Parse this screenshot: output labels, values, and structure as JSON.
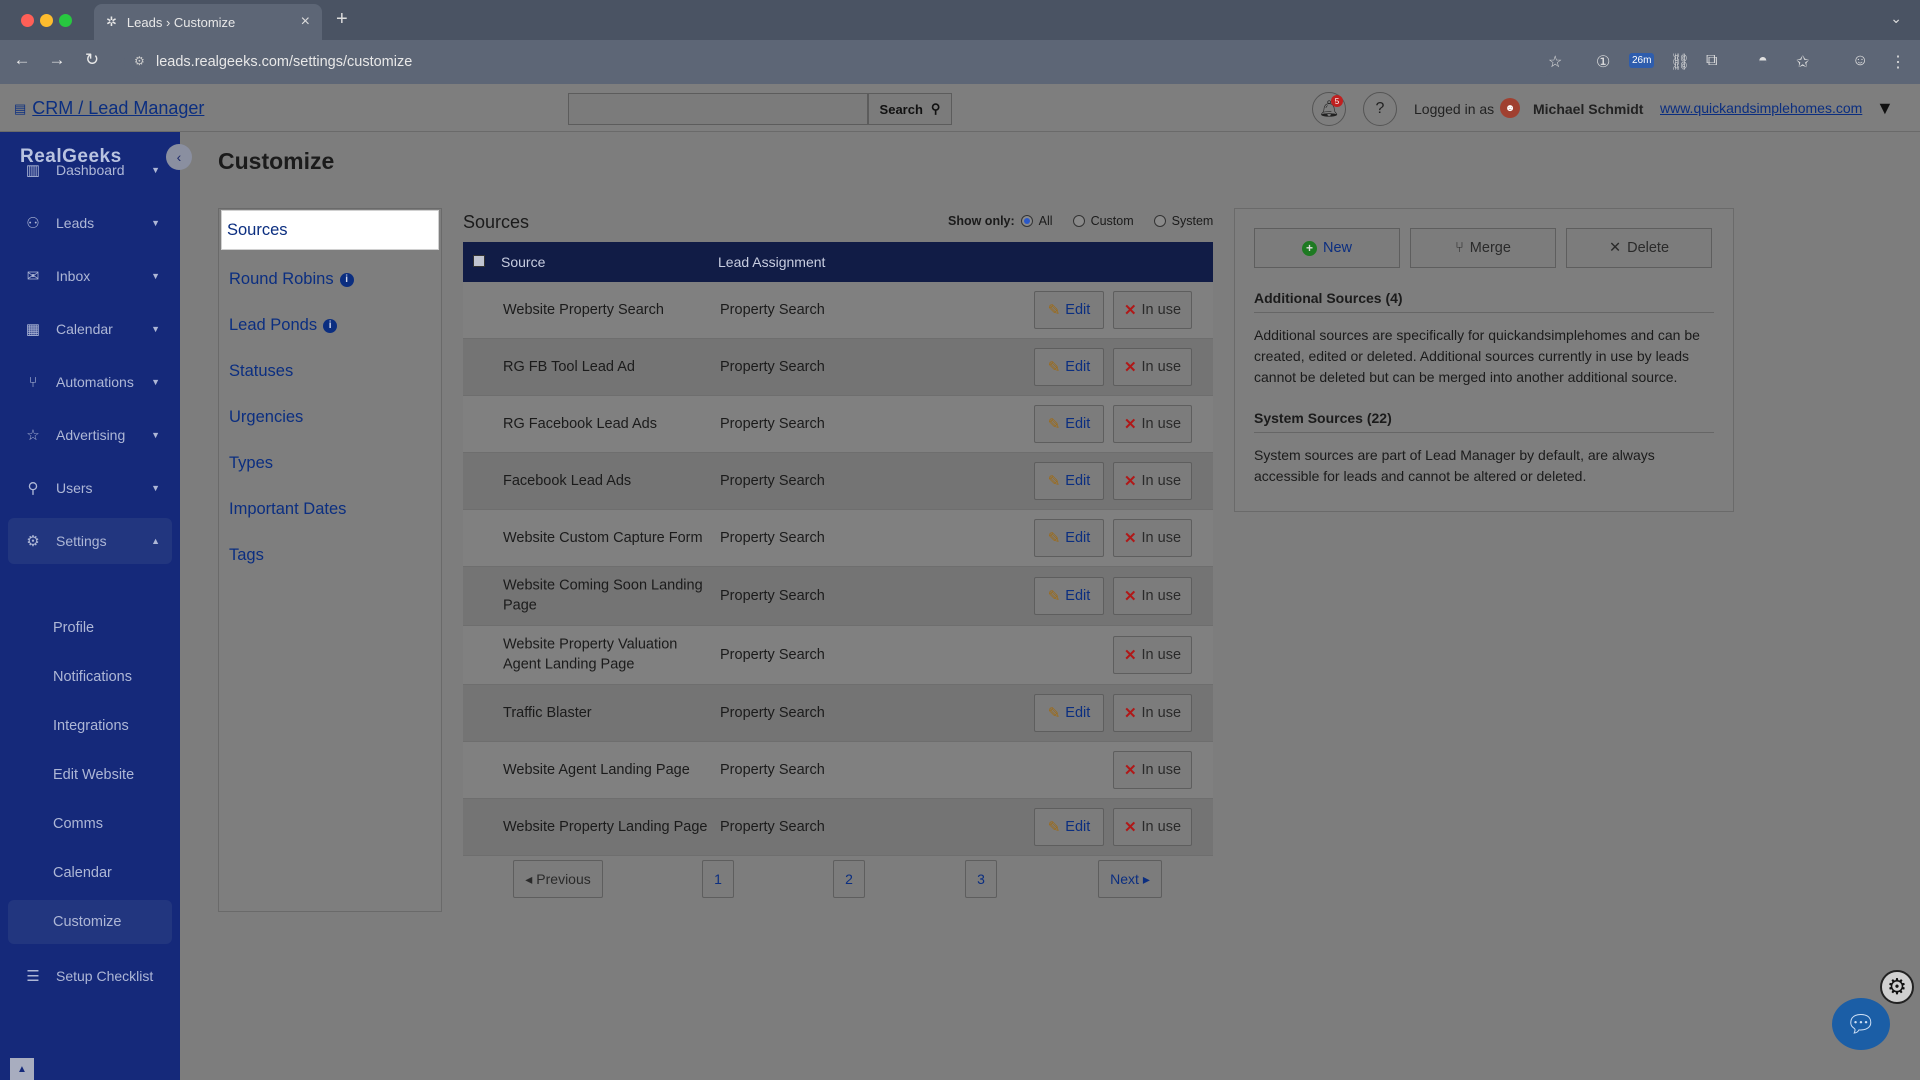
{
  "browser": {
    "tab_title": "Leads › Customize",
    "url": "leads.realgeeks.com/settings/customize",
    "ext_badge": "26m",
    "colors": {
      "close": "#ff5f57",
      "minimize": "#febc2e",
      "maximize": "#28c840"
    }
  },
  "header": {
    "app_link": "CRM / Lead Manager",
    "search_value": "",
    "search_button": "Search",
    "notification_count": "5",
    "logged_in_label": "Logged in as",
    "user_name": "Michael Schmidt",
    "site_link": "www.quickandsimplehomes.com"
  },
  "sidebar": {
    "logo": "RealGeeks",
    "items": [
      {
        "label": "Dashboard",
        "icon": "chart-icon"
      },
      {
        "label": "Leads",
        "icon": "people-icon"
      },
      {
        "label": "Inbox",
        "icon": "mail-icon"
      },
      {
        "label": "Calendar",
        "icon": "calendar-icon"
      },
      {
        "label": "Automations",
        "icon": "automation-icon"
      },
      {
        "label": "Advertising",
        "icon": "star-icon"
      },
      {
        "label": "Users",
        "icon": "user-icon"
      },
      {
        "label": "Settings",
        "icon": "gear-icon"
      }
    ],
    "settings_sub": [
      "Profile",
      "Notifications",
      "Integrations",
      "Edit Website",
      "Comms",
      "Calendar",
      "Customize"
    ],
    "setup_checklist": "Setup Checklist"
  },
  "main": {
    "title": "Customize",
    "subnav": [
      "Sources",
      "Round Robins",
      "Lead Ponds",
      "Statuses",
      "Urgencies",
      "Types",
      "Important Dates",
      "Tags"
    ],
    "sources_heading": "Sources",
    "show_only": {
      "label": "Show only:",
      "options": [
        "All",
        "Custom",
        "System"
      ],
      "selected": "All"
    },
    "table": {
      "columns": [
        "Source",
        "Lead Assignment"
      ],
      "edit_label": "Edit",
      "inuse_label": "In use",
      "rows": [
        {
          "source": "Website Property Search",
          "assignment": "Property Search",
          "editable": true
        },
        {
          "source": "RG FB Tool Lead Ad",
          "assignment": "Property Search",
          "editable": true
        },
        {
          "source": "RG Facebook Lead Ads",
          "assignment": "Property Search",
          "editable": true
        },
        {
          "source": "Facebook Lead Ads",
          "assignment": "Property Search",
          "editable": true
        },
        {
          "source": "Website Custom Capture Form",
          "assignment": "Property Search",
          "editable": true
        },
        {
          "source": "Website Coming Soon Landing Page",
          "assignment": "Property Search",
          "editable": true
        },
        {
          "source": "Website Property Valuation Agent Landing Page",
          "assignment": "Property Search",
          "editable": false
        },
        {
          "source": "Traffic Blaster",
          "assignment": "Property Search",
          "editable": true
        },
        {
          "source": "Website Agent Landing Page",
          "assignment": "Property Search",
          "editable": false
        },
        {
          "source": "Website Property Landing Page",
          "assignment": "Property Search",
          "editable": true
        }
      ]
    },
    "pagination": {
      "previous": "Previous",
      "pages": [
        "1",
        "2",
        "3"
      ],
      "next": "Next"
    },
    "panel": {
      "new": "New",
      "merge": "Merge",
      "delete": "Delete",
      "additional_heading": "Additional Sources (4)",
      "additional_text": "Additional sources are specifically for quickandsimplehomes and can be created, edited or deleted. Additional sources currently in use by leads cannot be deleted but can be merged into another additional source.",
      "system_heading": "System Sources (22)",
      "system_text": "System sources are part of Lead Manager by default, are always accessible for leads and cannot be altered or deleted."
    }
  }
}
